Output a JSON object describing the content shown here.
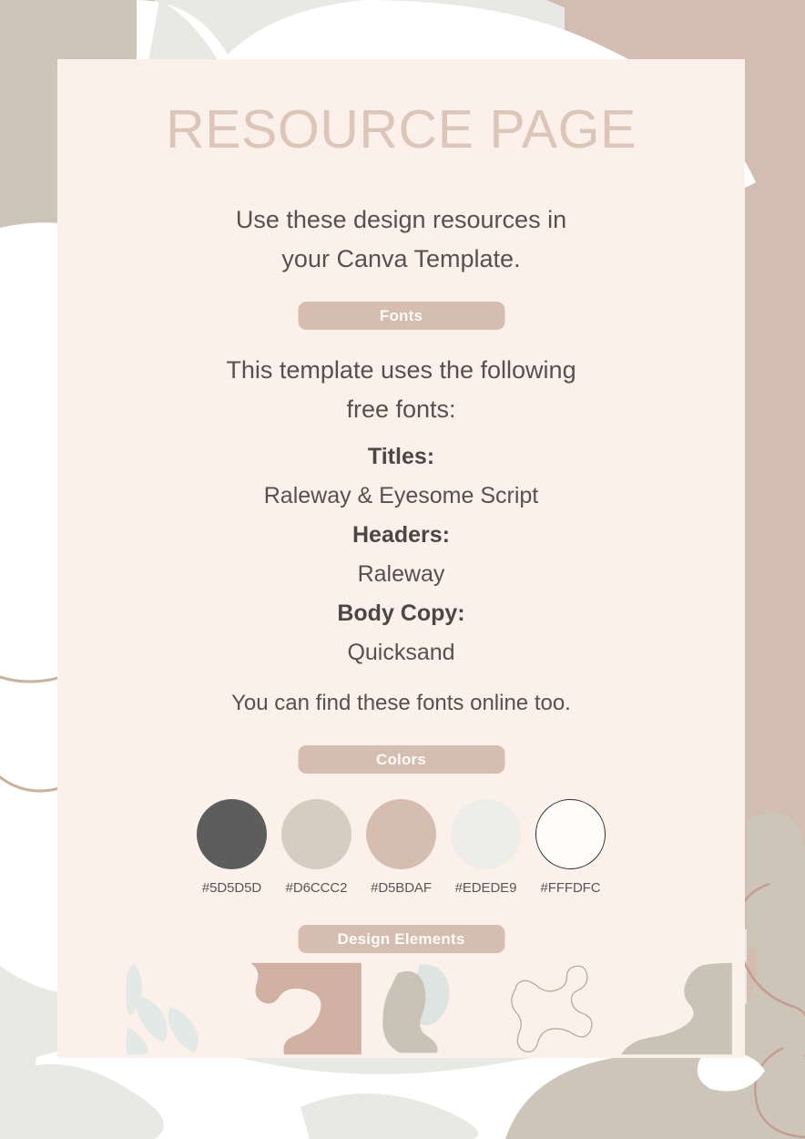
{
  "page": {
    "title": "RESOURCE PAGE",
    "intro_line1": "Use these design resources in",
    "intro_line2": "your Canva Template."
  },
  "fonts_section": {
    "badge": "Fonts",
    "intro_line1": "This template uses the following",
    "intro_line2": "free fonts:",
    "entries": [
      {
        "label": "Titles:",
        "value": "Raleway & Eyesome Script"
      },
      {
        "label": "Headers:",
        "value": "Raleway"
      },
      {
        "label": "Body Copy:",
        "value": "Quicksand"
      }
    ],
    "outro": "You can find these fonts online too."
  },
  "colors_section": {
    "badge": "Colors",
    "swatches": [
      {
        "hex": "#5D5D5D",
        "label": "#5D5D5D",
        "outlined": false
      },
      {
        "hex": "#D6CCC2",
        "label": "#D6CCC2",
        "outlined": false
      },
      {
        "hex": "#D5BDAF",
        "label": "#D5BDAF",
        "outlined": false
      },
      {
        "hex": "#EDEDE9",
        "label": "#EDEDE9",
        "outlined": false
      },
      {
        "hex": "#FFFDFC",
        "label": "#FFFDFC",
        "outlined": true
      }
    ]
  },
  "design_elements_section": {
    "badge": "Design Elements",
    "tiles": [
      {
        "name": "pale-leaf-branch-shape"
      },
      {
        "name": "rose-organic-cutout-shape"
      },
      {
        "name": "taupe-blob-with-mint-accent"
      },
      {
        "name": "outline-amoeba-shape"
      },
      {
        "name": "taupe-corner-wave-shape"
      }
    ]
  },
  "theme": {
    "card_background": "#FCF1EA",
    "title_color": "#DCC5B9",
    "body_text_color": "#56514F",
    "badge_background": "#D5BDAF",
    "badge_text_color": "#FFFBF8",
    "page_background": "#E8E8E4",
    "accent_rose": "#D3BCB2",
    "accent_taupe": "#CEC5BA",
    "accent_mint": "#DDE5E2"
  }
}
